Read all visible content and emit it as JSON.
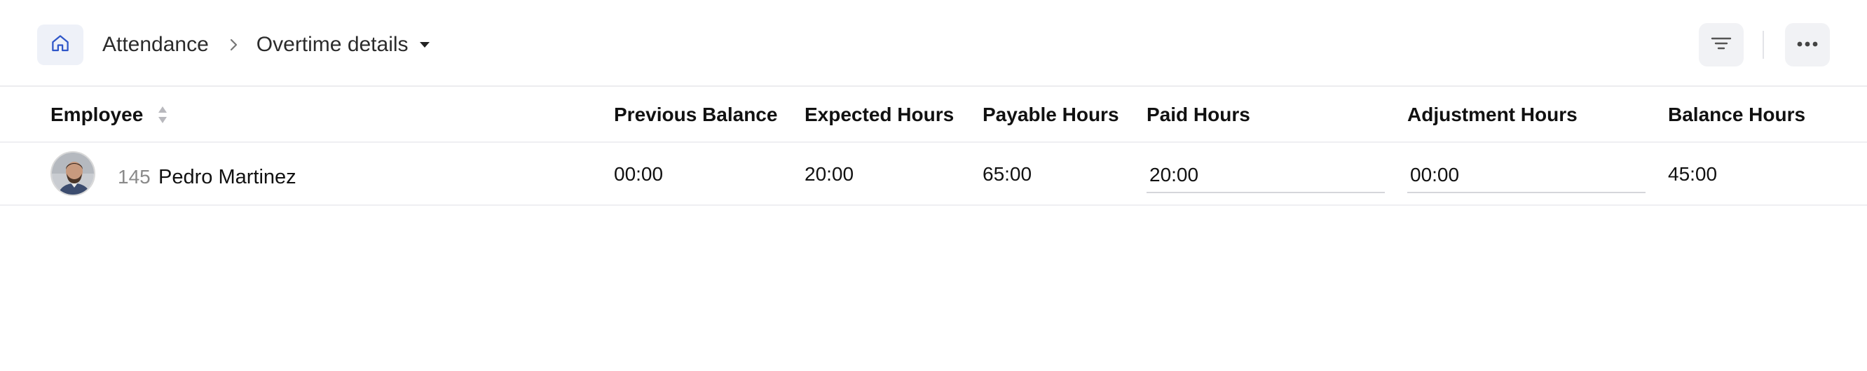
{
  "header": {
    "breadcrumb_root": "Attendance",
    "breadcrumb_current": "Overtime details"
  },
  "table": {
    "columns": {
      "employee": "Employee",
      "previous_balance": "Previous Balance",
      "expected_hours": "Expected Hours",
      "payable_hours": "Payable Hours",
      "paid_hours": "Paid Hours",
      "adjustment_hours": "Adjustment Hours",
      "balance_hours": "Balance Hours"
    },
    "rows": [
      {
        "employee_id": "145",
        "employee_name": "Pedro Martinez",
        "previous_balance": "00:00",
        "expected_hours": "20:00",
        "payable_hours": "65:00",
        "paid_hours": "20:00",
        "adjustment_hours": "00:00",
        "balance_hours": "45:00"
      }
    ]
  },
  "icons": {
    "home": "home-icon",
    "breadcrumb_separator": "chevron-right-icon",
    "dropdown": "caret-down-icon",
    "filter": "filter-icon",
    "more": "more-horizontal-icon",
    "sort": "sort-icon"
  },
  "colors": {
    "home_icon": "#2f56c8",
    "button_bg": "#f1f2f5",
    "border": "#efeff2"
  }
}
